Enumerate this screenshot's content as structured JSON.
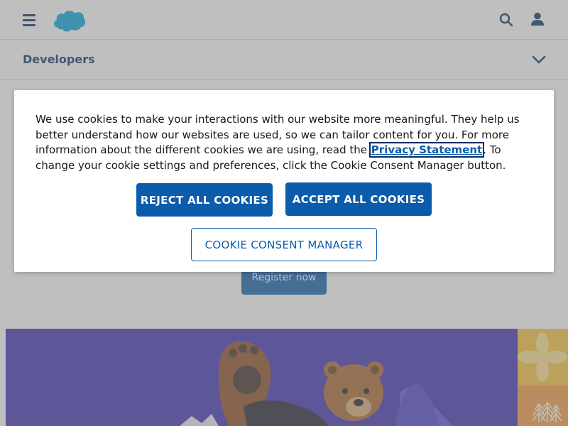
{
  "header": {
    "menu_icon": "hamburger-menu-icon",
    "logo_icon": "salesforce-cloud-logo",
    "search_icon": "search-icon",
    "user_icon": "user-profile-icon"
  },
  "subnav": {
    "title": "Developers",
    "chevron_icon": "chevron-down-icon"
  },
  "hero": {
    "register_label": "Register now"
  },
  "cookie_banner": {
    "text_before_link": "We use cookies to make your interactions with our website more meaningful. They help us better understand how our websites are used, so we can tailor content for you. For more information about the different cookies we are using, read the ",
    "privacy_link": "Privacy Statement",
    "text_after_link": ". To change your cookie settings and preferences, click the Cookie Consent Manager button.",
    "reject_label": "REJECT ALL COOKIES",
    "accept_label": "ACCEPT ALL COOKIES",
    "manager_label": "COOKIE CONSENT MANAGER"
  },
  "colors": {
    "brand_blue": "#0b5cab",
    "navy": "#032d60",
    "promo_purple": "#3a2fb5",
    "tile_yellow": "#f6c237",
    "tile_orange": "#f29a41",
    "logo_blue": "#00a1e0"
  }
}
